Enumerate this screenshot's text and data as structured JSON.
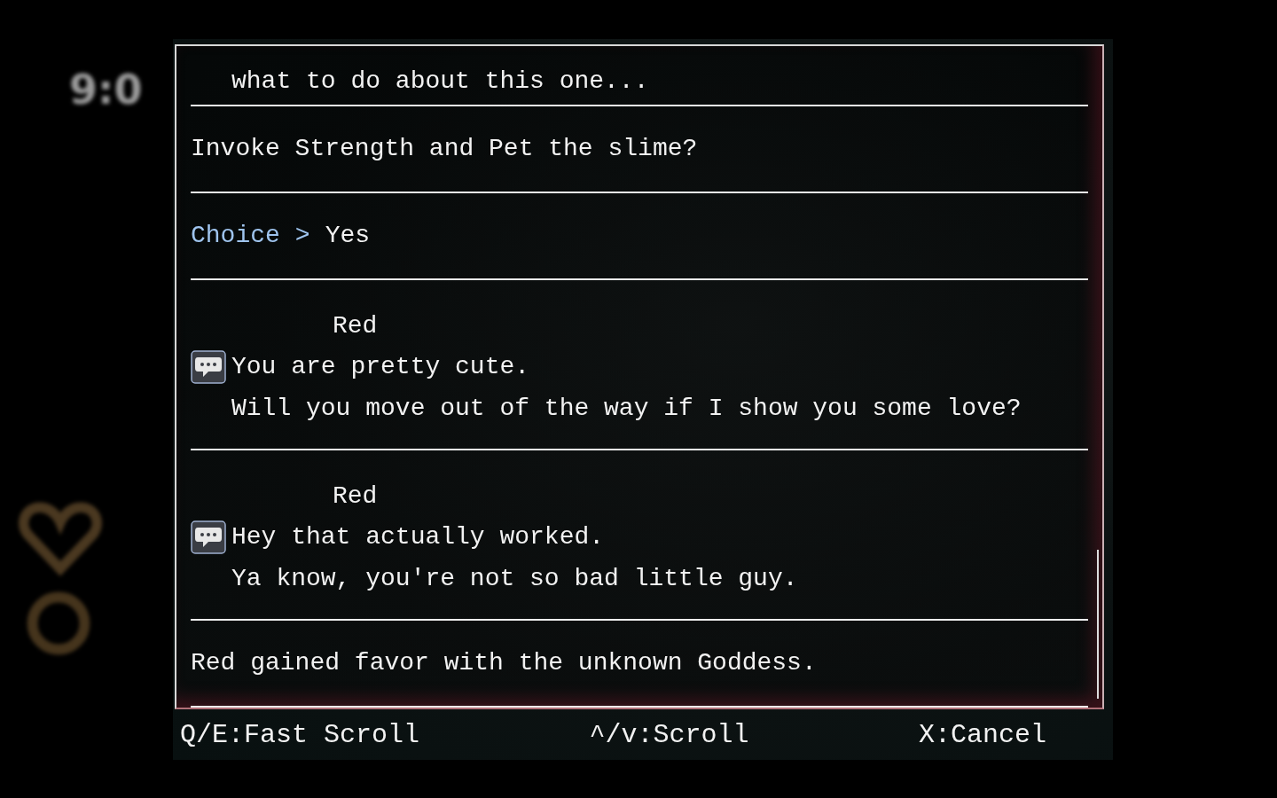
{
  "hud": {
    "time": "9:0"
  },
  "log": [
    {
      "kind": "continuation",
      "text": "what to do about this one..."
    },
    {
      "kind": "narration",
      "text": "Invoke Strength and Pet the slime?"
    },
    {
      "kind": "choice",
      "label": "Choice",
      "separator": ">",
      "text": "Yes"
    },
    {
      "kind": "dialogue",
      "speaker": "Red",
      "lines": [
        "You are pretty cute.",
        "Will you move out of the way if I show you some love?"
      ]
    },
    {
      "kind": "dialogue",
      "speaker": "Red",
      "lines": [
        "Hey that actually worked.",
        "Ya know, you're not so bad little guy."
      ]
    },
    {
      "kind": "narration",
      "text": "Red gained favor with the unknown Goddess."
    }
  ],
  "footer": [
    "Q/E:Fast Scroll",
    "^/v:Scroll",
    "X:Cancel"
  ]
}
